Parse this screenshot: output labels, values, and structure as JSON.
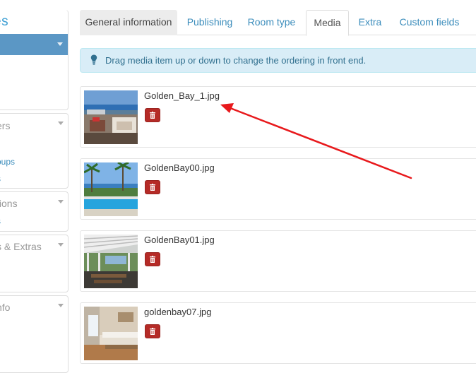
{
  "sidebar": {
    "brand": "es",
    "sections": [
      {
        "title": "ers",
        "links": [
          "oups",
          "s"
        ]
      },
      {
        "title": "tions",
        "links": [
          "s"
        ]
      },
      {
        "title": "s & Extras",
        "links": []
      },
      {
        "title": "nfo",
        "links": []
      }
    ]
  },
  "tabs": [
    {
      "label": "General information"
    },
    {
      "label": "Publishing"
    },
    {
      "label": "Room type"
    },
    {
      "label": "Media"
    },
    {
      "label": "Extra"
    },
    {
      "label": "Custom fields"
    }
  ],
  "active_tab": "Media",
  "alert": {
    "text": "Drag media item up or down to change the ordering in front end.",
    "icon": "lightbulb-icon"
  },
  "media_items": [
    {
      "filename": "Golden_Bay_1.jpg",
      "thumb": "terrace-sea-view"
    },
    {
      "filename": "GoldenBay00.jpg",
      "thumb": "pool-palms"
    },
    {
      "filename": "GoldenBay01.jpg",
      "thumb": "pergola-dining"
    },
    {
      "filename": "goldenbay07.jpg",
      "thumb": "hotel-room"
    }
  ],
  "delete_icon": "trash-icon",
  "colors": {
    "accent": "#3c8dbc",
    "sidebar_active": "#5b97c5",
    "alert_bg": "#d9edf7",
    "alert_text": "#31708f",
    "danger": "#b52b27",
    "annotation": "#e8191c"
  }
}
